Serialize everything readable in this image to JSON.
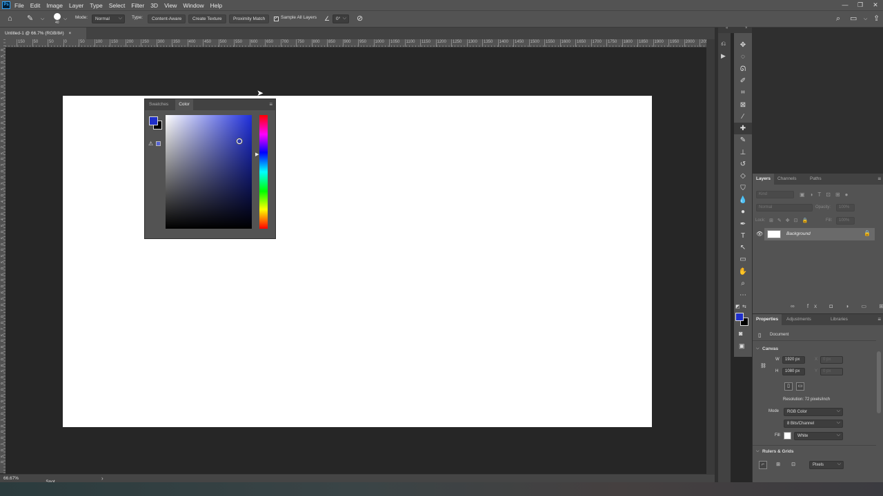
{
  "app": {
    "logo": "Ps"
  },
  "menu": [
    "File",
    "Edit",
    "Image",
    "Layer",
    "Type",
    "Select",
    "Filter",
    "3D",
    "View",
    "Window",
    "Help"
  ],
  "window_controls": {
    "minimize": "—",
    "restore": "❐",
    "close": "✕"
  },
  "options": {
    "brush_size": "40",
    "mode_label": "Mode:",
    "mode_value": "Normal",
    "type_label": "Type:",
    "type_options": [
      "Content-Aware",
      "Create Texture",
      "Proximity Match"
    ],
    "sample_all_layers": "Sample All Layers",
    "angle_value": "0°"
  },
  "doc_tab": {
    "title": "Untitled-1 @ 66.7% (RGB/8#)",
    "close": "×"
  },
  "ruler": {
    "h_labels": [
      "150",
      "50",
      "50",
      "0",
      "50",
      "100",
      "150",
      "200",
      "250",
      "300",
      "350",
      "400",
      "450",
      "500",
      "550",
      "600",
      "650",
      "700",
      "750",
      "800",
      "850",
      "900",
      "950",
      "1000",
      "1050",
      "1100",
      "1150",
      "1200",
      "1250",
      "1300",
      "1350",
      "1400",
      "1450",
      "1500",
      "1550",
      "1600",
      "1650",
      "1700",
      "1750",
      "1800",
      "1850",
      "1900",
      "1950",
      "2000",
      "2050"
    ],
    "v_labels": [
      "0",
      "5",
      "0",
      "5",
      "0",
      "1",
      "0",
      "1",
      "5",
      "0",
      "1",
      "5",
      "0",
      "2",
      "0",
      "0",
      "2",
      "5",
      "0",
      "3",
      "0",
      "0",
      "3",
      "5",
      "0",
      "4",
      "0",
      "0",
      "4",
      "5",
      "0",
      "5",
      "0",
      "0",
      "5",
      "5",
      "0",
      "6",
      "0",
      "0",
      "6",
      "5",
      "0",
      "7",
      "0",
      "0",
      "7",
      "5",
      "0",
      "8",
      "0",
      "0",
      "8",
      "5",
      "0",
      "9",
      "0",
      "0",
      "9",
      "5",
      "0",
      "1",
      "0",
      "0",
      "0",
      "1",
      "0",
      "5",
      "0"
    ]
  },
  "color_panel": {
    "tabs": [
      "Swatches",
      "Color"
    ],
    "active_tab": "Color",
    "foreground_hex": "#1f2fc9",
    "background_hex": "#000000"
  },
  "status": {
    "zoom": "66.67%",
    "tool": "Spot Healing Brush",
    "arrow": "›"
  },
  "tools": [
    "move-icon",
    "marquee-icon",
    "lasso-icon",
    "quick-select-icon",
    "crop-icon",
    "frame-icon",
    "eyedropper-icon",
    "spot-healing-icon",
    "brush-icon",
    "clone-stamp-icon",
    "history-brush-icon",
    "eraser-icon",
    "paint-bucket-icon",
    "blur-icon",
    "dodge-icon",
    "pen-icon",
    "type-icon",
    "path-select-icon",
    "rectangle-icon",
    "hand-icon",
    "zoom-icon",
    "more-icon"
  ],
  "layers_panel": {
    "tabs": [
      "Layers",
      "Channels",
      "Paths"
    ],
    "kind_placeholder": "Kind",
    "blend_mode": "Normal",
    "opacity_label": "Opacity:",
    "opacity_value": "100%",
    "lock_label": "Lock:",
    "fill_label": "Fill:",
    "fill_value": "100%",
    "layers": [
      {
        "name": "Background"
      }
    ],
    "footer_icons": "∞ fx ◘ ◑ ▭ ⊞ 🗑"
  },
  "properties_panel": {
    "tabs": [
      "Properties",
      "Adjustments",
      "Libraries"
    ],
    "document_label": "Document",
    "canvas_section": "Canvas",
    "w_label": "W",
    "w_value": "1920 px",
    "h_label": "H",
    "h_value": "1080 px",
    "x_label": "X",
    "x_placeholder": "0 px",
    "y_label": "Y",
    "y_placeholder": "0 px",
    "resolution": "Resolution: 72 pixels/inch",
    "mode_label": "Mode",
    "mode_value": "RGB Color",
    "bits_value": "8 Bits/Channel",
    "fill_label": "Fill",
    "fill_value": "White",
    "rulers_section": "Rulers & Grids",
    "units_value": "Pixels"
  }
}
